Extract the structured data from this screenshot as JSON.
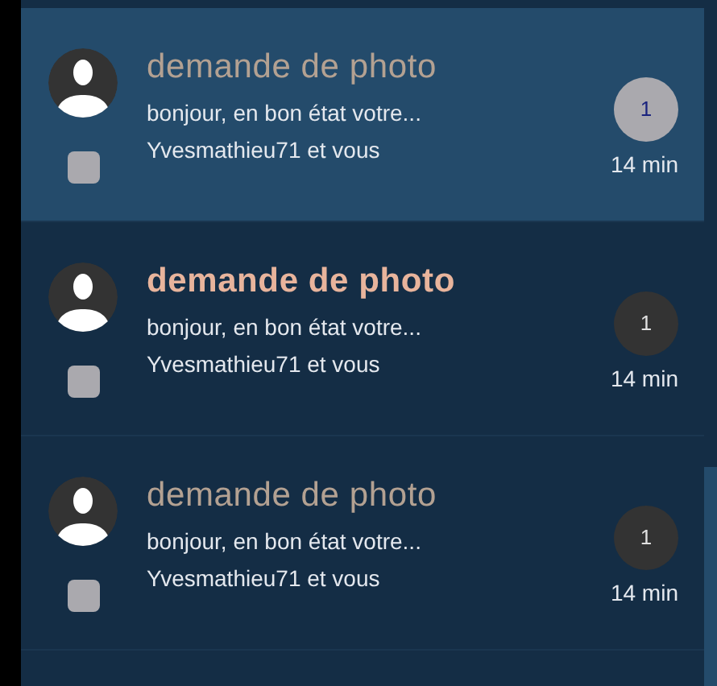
{
  "conversations": [
    {
      "title": "demande de photo",
      "preview": "bonjour, en bon état votre...",
      "participants": "Yvesmathieu71 et vous",
      "count": "1",
      "time": "14 min",
      "selected": true,
      "unread": false,
      "checked": false
    },
    {
      "title": "demande de photo",
      "preview": "bonjour, en bon état votre...",
      "participants": "Yvesmathieu71 et vous",
      "count": "1",
      "time": "14 min",
      "selected": false,
      "unread": true,
      "checked": false
    },
    {
      "title": "demande de photo",
      "preview": "bonjour, en bon état votre...",
      "participants": "Yvesmathieu71 et vous",
      "count": "1",
      "time": "14 min",
      "selected": false,
      "unread": false,
      "checked": false
    }
  ]
}
